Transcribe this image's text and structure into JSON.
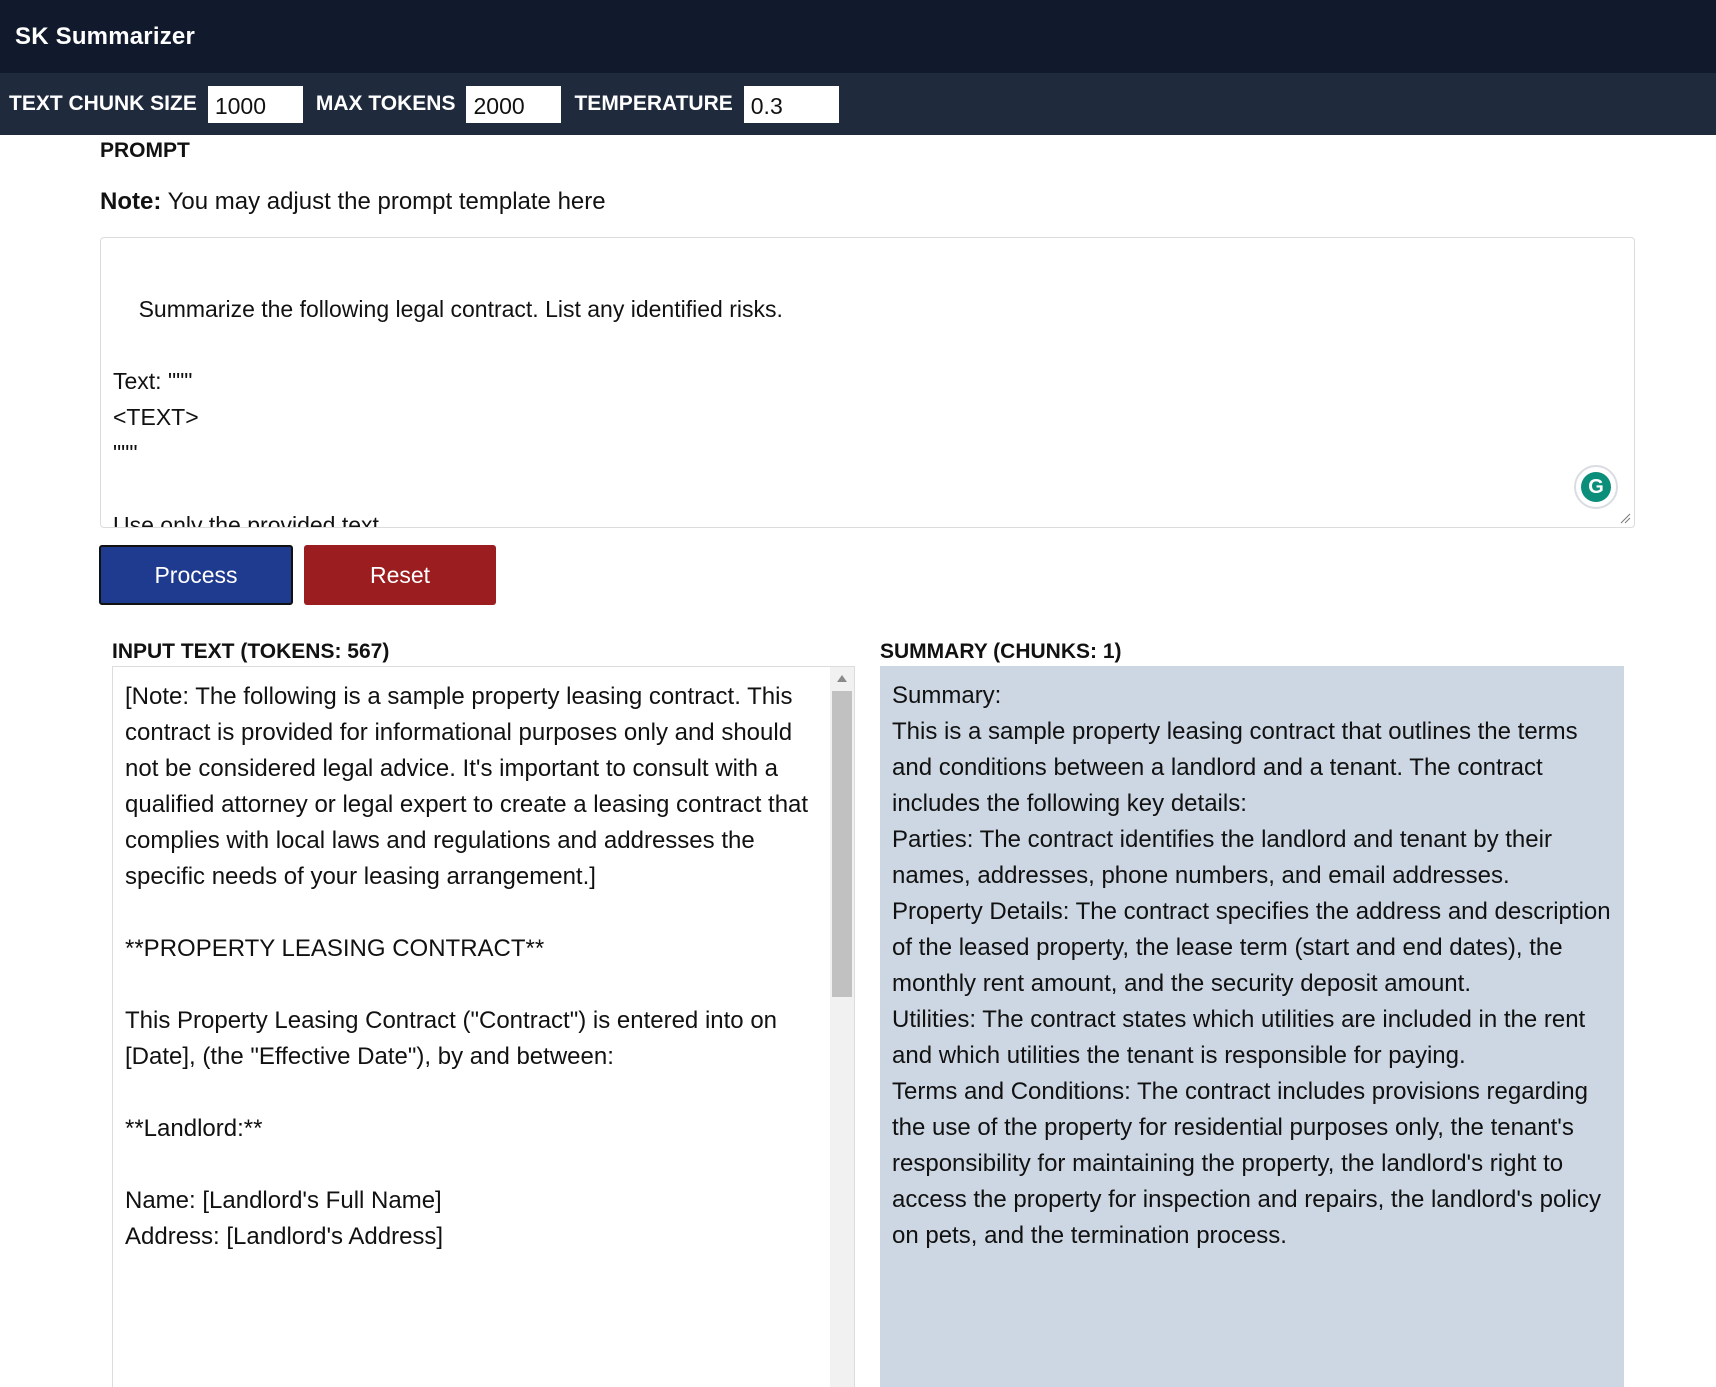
{
  "app": {
    "title": "SK Summarizer"
  },
  "settings": {
    "chunk_size_label": "TEXT CHUNK SIZE",
    "chunk_size_value": "1000",
    "max_tokens_label": "MAX TOKENS",
    "max_tokens_value": "2000",
    "temperature_label": "TEMPERATURE",
    "temperature_value": "0.3"
  },
  "prompt": {
    "heading": "PROMPT",
    "note_bold": "Note:",
    "note_text": " You may adjust the prompt template here",
    "template": "Summarize the following legal contract. List any identified risks.\n\nText: \"\"\"\n<TEXT>\n\"\"\"\n\nUse only the provided text."
  },
  "actions": {
    "process_label": "Process",
    "reset_label": "Reset"
  },
  "input": {
    "heading": "INPUT TEXT (TOKENS: 567)",
    "text": "[Note: The following is a sample property leasing contract. This contract is provided for informational purposes only and should not be considered legal advice. It's important to consult with a qualified attorney or legal expert to create a leasing contract that complies with local laws and regulations and addresses the specific needs of your leasing arrangement.]\n\n**PROPERTY LEASING CONTRACT**\n\nThis Property Leasing Contract (\"Contract\") is entered into on [Date], (the \"Effective Date\"), by and between:\n\n**Landlord:**\n\nName: [Landlord's Full Name]\nAddress: [Landlord's Address]"
  },
  "summary": {
    "heading": "SUMMARY (CHUNKS: 1)",
    "lines": [
      "Summary:",
      "This is a sample property leasing contract that outlines the terms and conditions between a landlord and a tenant. The contract includes the following key details:",
      "Parties: The contract identifies the landlord and tenant by their names, addresses, phone numbers, and email addresses.",
      "Property Details: The contract specifies the address and description of the leased property, the lease term (start and end dates), the monthly rent amount, and the security deposit amount.",
      "Utilities: The contract states which utilities are included in the rent and which utilities the tenant is responsible for paying.",
      "Terms and Conditions: The contract includes provisions regarding the use of the property for residential purposes only, the tenant's responsibility for maintaining the property, the landlord's right to access the property for inspection and repairs, the landlord's policy on pets, and the termination process."
    ]
  },
  "icons": {
    "grammarly": "grammarly-icon",
    "resize": "resize-grip-icon",
    "scroll_up": "scroll-up-arrow-icon"
  }
}
